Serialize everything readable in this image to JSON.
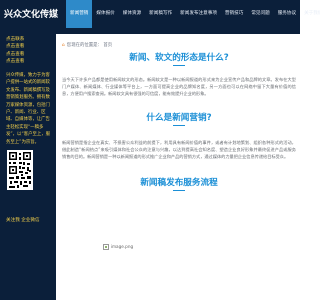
{
  "header": {
    "brand": "兴众文化传媒",
    "nav": [
      {
        "label": "新闻营销",
        "active": true
      },
      {
        "label": "媒体报价",
        "active": false
      },
      {
        "label": "媒体资源",
        "active": false
      },
      {
        "label": "新闻稿写作",
        "active": false
      },
      {
        "label": "新闻发布注意事项",
        "active": false
      },
      {
        "label": "营销技巧",
        "active": false
      },
      {
        "label": "常见问题",
        "active": false
      },
      {
        "label": "服务协议",
        "active": false
      },
      {
        "label": "关于我们",
        "active": false
      }
    ]
  },
  "sidebar": {
    "links": [
      "点击联系",
      "点击查看",
      "点击查看",
      "点击查看"
    ],
    "description": "兴众传媒，致力于为客户提供一站式的新闻软文发布、新闻稿撰写及营销策划服务。拥有数万家媒体资源，包括门户、新闻、行业、区域、自媒体等，让广告主轻松实现“一稿多发”，以“客户至上，服务至上”为宗旨。",
    "footer": "关注我 企业微信"
  },
  "breadcrumb": {
    "home": "首页",
    "text": "您现在的位置是： 首页"
  },
  "sections": [
    {
      "title": "新闻、软文的形态是什么?",
      "paragraph": "当今天下许多产品都是使用新闻软文的形态。新闻软文是一种以新闻报道的形式来为企业宣传产品和品牌的文章。发布在大型门户媒体、新闻媒体、行业媒体等平台上，一方面可提高企业的品牌知名度，另一方面也可以在网络中留下大量有价值的信息，方便用户搜索查阅。新闻软文具有很强的可信度，能有效提升企业的形象。"
    },
    {
      "title": "什么是新闻营销?",
      "paragraph": "新闻营销是指企业在真实、不损害公众利益的前提下，利用具有新闻价值的事件，或者有计划地策划、组织各种形式的活动，借此制造“新闻热点”来吸引媒体和社会公众的注意与兴趣，以达到提高社会知名度、塑造企业良好形象并最终促进产品或服务销售的目的。新闻营销是一种以新闻报道的形式推广企业和产品的营销方式，通过媒体的力量把企业信息传递给目标受众。"
    },
    {
      "title": "新闻稿发布服务流程",
      "paragraph": ""
    }
  ],
  "image": {
    "alt": "image.png"
  }
}
